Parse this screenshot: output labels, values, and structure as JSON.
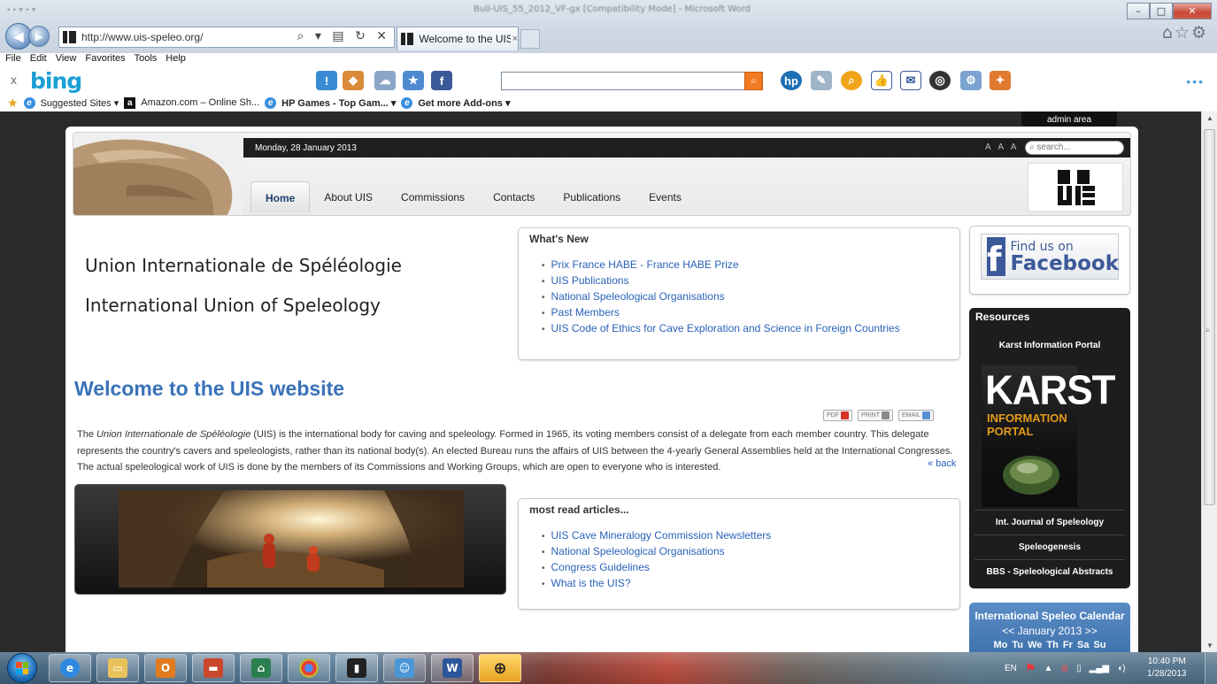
{
  "window": {
    "ghost_title": "Bull-UIS_55_2012_VF-gx [Compatibility Mode] - Microsoft Word",
    "min": "–",
    "max": "□",
    "close": "✕"
  },
  "browser": {
    "address": "http://www.uis-speleo.org/",
    "address_tools": "⌕ ▾ ▤ ↻ ✕",
    "tab_title": "Welcome to the UIS...",
    "tab_close": "×",
    "right_icons": "⌂☆⚙"
  },
  "menu": [
    "File",
    "Edit",
    "View",
    "Favorites",
    "Tools",
    "Help"
  ],
  "bing": {
    "close": "x",
    "logo": "bing",
    "search_placeholder": "",
    "more": "•••"
  },
  "favorites": {
    "suggested": "Suggested Sites ▾",
    "amazon": "Amazon.com – Online Sh...",
    "hpgames": "HP Games - Top Gam... ▾",
    "addons": "Get more Add-ons ▾"
  },
  "site": {
    "admin_area": "admin area",
    "date": "Monday, 28 January 2013",
    "font_size_controls": "A A A",
    "search_placeholder": "search...",
    "nav": [
      "Home",
      "About UIS",
      "Commissions",
      "Contacts",
      "Publications",
      "Events"
    ],
    "org_name_fr": "Union Internationale de Spéléologie",
    "org_name_en": "International Union of Speleology",
    "whats_new": {
      "title": "What's New",
      "items": [
        "Prix France HABE - France HABE Prize",
        "UIS Publications",
        "National Speleological Organisations",
        "Past Members",
        "UIS Code of Ethics for Cave Exploration and Science in Foreign Countries"
      ]
    },
    "welcome_title": "Welcome to the UIS website",
    "actions": {
      "pdf": "PDF",
      "print": "PRINT",
      "email": "EMAIL"
    },
    "intro": {
      "pre": "The ",
      "italic": "Union Internationale de Spéléologie",
      "post": " (UIS) is the international body for caving and speleology. Formed in 1965, its voting members consist of a delegate from each member country. This delegate represents the country's cavers and speleologists, rather than its national body(s). An elected Bureau runs the affairs of UIS between the 4-yearly General Assemblies held at the International Congresses. The actual speleological work of UIS is done by the members of its Commissions and Working Groups, which are open to everyone who is interested."
    },
    "back": "« back",
    "most_read": {
      "title": "most read articles...",
      "items": [
        "UIS Cave Mineralogy Commission Newsletters",
        "National Speleological Organisations",
        "Congress Guidelines",
        "What is the UIS?"
      ]
    },
    "facebook": {
      "line1": "Find us on",
      "line2": "Facebook",
      "letter": "f"
    },
    "resources": {
      "title": "Resources",
      "karst_portal": "Karst Information Portal",
      "karst_word": "KARST",
      "karst_sub1": "INFORMATION",
      "karst_sub2": "PORTAL",
      "links": [
        "Int. Journal of Speleology",
        "Speleogenesis",
        "BBS - Speleological Abstracts"
      ]
    },
    "calendar": {
      "title": "International Speleo Calendar",
      "nav": "<<  January 2013  >>",
      "days": "Mo Tu We Th Fr Sa Su"
    },
    "logo_text": "UIS"
  },
  "taskbar": {
    "lang": "EN",
    "time": "10:40 PM",
    "date": "1/28/2013"
  },
  "colors": {
    "link": "#2a62b8",
    "title_blue": "#3a72b8",
    "facebook": "#3b5998",
    "karst_orange": "#e39a1c"
  }
}
